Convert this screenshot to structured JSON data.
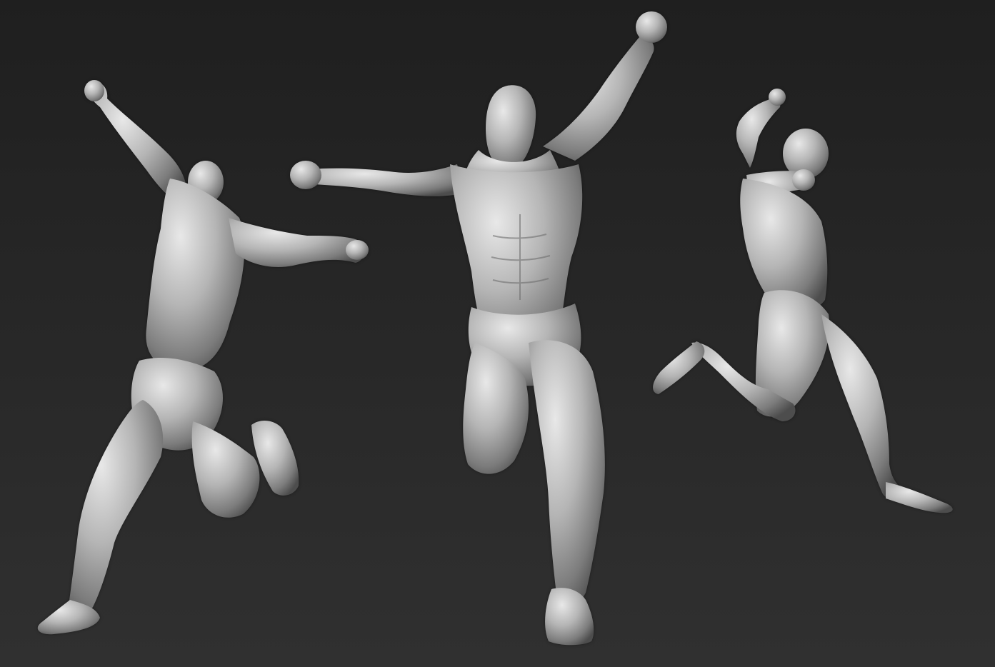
{
  "viewport": {
    "background_top": "#1f1f1f",
    "background_bottom": "#303030",
    "material_highlight": "#e6e6e6",
    "material_mid": "#a6a6a6",
    "material_shadow": "#4a4a4a"
  },
  "figures": [
    {
      "icon": "sculpt-figure-back-view-icon"
    },
    {
      "icon": "sculpt-figure-front-view-icon"
    },
    {
      "icon": "sculpt-figure-side-view-icon"
    }
  ]
}
